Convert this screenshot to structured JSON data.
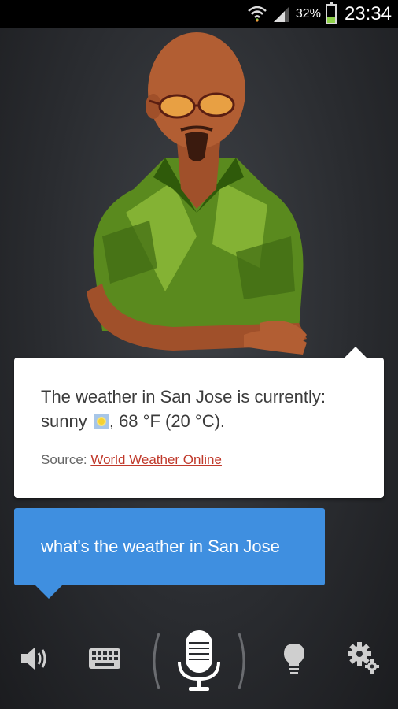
{
  "status_bar": {
    "battery_percent": "32%",
    "battery_level": 0.32,
    "time": "23:34"
  },
  "answer": {
    "line1": "The weather in San Jose is currently:",
    "line2_prefix": "sunny",
    "line2_suffix": ", 68 °F (20 °C).",
    "source_label": "Source:",
    "source_link": "World Weather Online",
    "weather_icon": "sunny-icon"
  },
  "query": {
    "text": "what's the weather in San Jose"
  },
  "toolbar": {
    "icons": [
      "speaker-icon",
      "keyboard-icon",
      "microphone-icon",
      "lightbulb-icon",
      "settings-icon"
    ]
  },
  "colors": {
    "query_bubble": "#3f8fe0",
    "link": "#c0392b",
    "battery": "#8fd14a"
  }
}
